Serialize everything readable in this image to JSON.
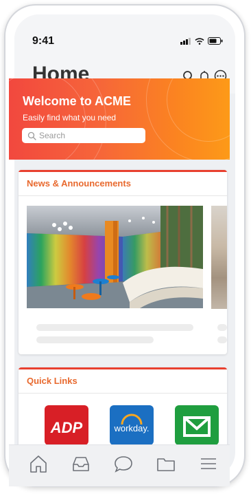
{
  "status": {
    "time": "9:41"
  },
  "header": {
    "title": "Home"
  },
  "banner": {
    "headline": "Welcome to ACME",
    "subtitle": "Easily find what you need",
    "search_placeholder": "Search"
  },
  "news": {
    "title": "News & Announcements"
  },
  "quick_links": {
    "title": "Quick Links",
    "items": [
      {
        "label": "ADP",
        "color": "#d81f26"
      },
      {
        "label": "workday.",
        "color": "#1b6fc2"
      },
      {
        "label": "Mail",
        "color": "#1f9e3f"
      }
    ]
  },
  "tabs": [
    "home-tab",
    "inbox-tab",
    "chat-tab",
    "folder-tab",
    "menu-tab"
  ],
  "colors": {
    "accent": "#e8692e",
    "banner_start": "#f2483e",
    "banner_end": "#fd9a18"
  }
}
